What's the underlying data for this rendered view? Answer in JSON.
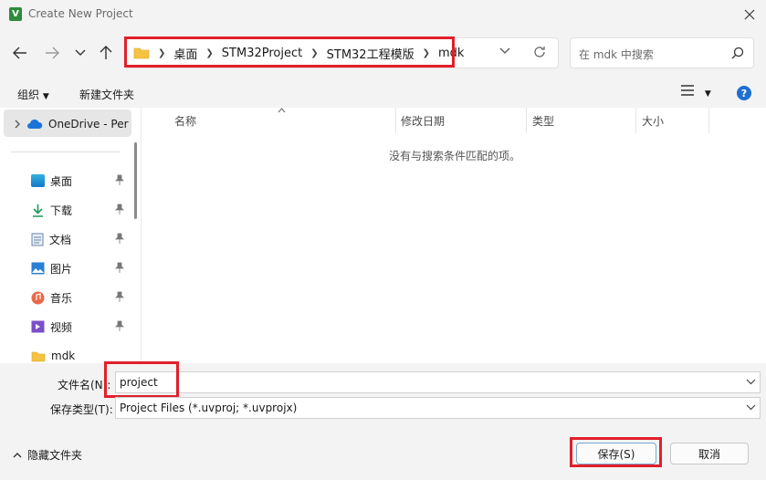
{
  "window": {
    "title": "Create New Project"
  },
  "nav": {
    "breadcrumbs": [
      "桌面",
      "STM32Project",
      "STM32工程模版",
      "mdk"
    ],
    "search_placeholder": "在 mdk 中搜索"
  },
  "toolbar": {
    "organize": "组织",
    "new_folder": "新建文件夹"
  },
  "sidebar": {
    "onedrive": "OneDrive - Per",
    "items": [
      {
        "label": "桌面",
        "icon": "desktop-icon",
        "pinned": true
      },
      {
        "label": "下载",
        "icon": "download-icon",
        "pinned": true
      },
      {
        "label": "文档",
        "icon": "document-icon",
        "pinned": true
      },
      {
        "label": "图片",
        "icon": "pictures-icon",
        "pinned": true
      },
      {
        "label": "音乐",
        "icon": "music-icon",
        "pinned": true
      },
      {
        "label": "视频",
        "icon": "video-icon",
        "pinned": true
      },
      {
        "label": "mdk",
        "icon": "folder-icon",
        "pinned": false
      }
    ]
  },
  "filelist": {
    "columns": [
      "名称",
      "修改日期",
      "类型",
      "大小"
    ],
    "empty_message": "没有与搜索条件匹配的项。"
  },
  "form": {
    "filename_label": "文件名(N):",
    "filename_value": "project",
    "filetype_label": "保存类型(T):",
    "filetype_value": "Project Files (*.uvproj; *.uvprojx)"
  },
  "footer": {
    "hide_folders": "隐藏文件夹",
    "save": "保存(S)",
    "cancel": "取消"
  },
  "colors": {
    "highlight": "#e0202a",
    "folder": "#f5c342",
    "help": "#1f6fd1"
  }
}
